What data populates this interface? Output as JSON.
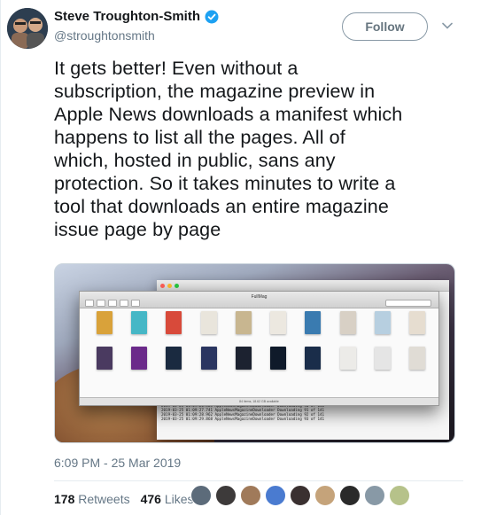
{
  "author": {
    "name": "Steve Troughton-Smith",
    "handle": "@stroughtonsmith",
    "verified": true
  },
  "follow_label": "Follow",
  "tweet": {
    "text": "It gets better! Even without a\nsubscription, the magazine preview in\nApple News downloads a manifest which\nhappens to list all the pages. All of\nwhich, hosted in public, sans any\nprotection. So it takes minutes to write a\ntool that downloads an entire magazine\nissue page by page"
  },
  "timestamp": "6:09 PM - 25 Mar 2019",
  "stats": {
    "retweets_count": "178",
    "retweets_label": "Retweets",
    "likes_count": "476",
    "likes_label": "Likes"
  },
  "colors": {
    "verified": "#1da1f2",
    "muted": "#657786",
    "text": "#14171a"
  },
  "likers": [
    "#5c6b7a",
    "#3d3a3a",
    "#a07a5a",
    "#4a7bd0",
    "#3a3030",
    "#c5a37a",
    "#2a2a2a",
    "#8899a6",
    "#b6c28a"
  ],
  "finder_thumbs": [
    "#d9a23a",
    "#46b7c6",
    "#d84a3a",
    "#e9e5dc",
    "#c8b690",
    "#ece8e0",
    "#3a7bb0",
    "#d8d0c5",
    "#b7cfe0",
    "#e6ddd0",
    "#4a3a60",
    "#6b2a8a",
    "#1a2a40",
    "#2a3560",
    "#1c2230",
    "#0f1a2a",
    "#1a2d4a",
    "#ecebe8",
    "#e5e5e5",
    "#e0dcd5"
  ]
}
